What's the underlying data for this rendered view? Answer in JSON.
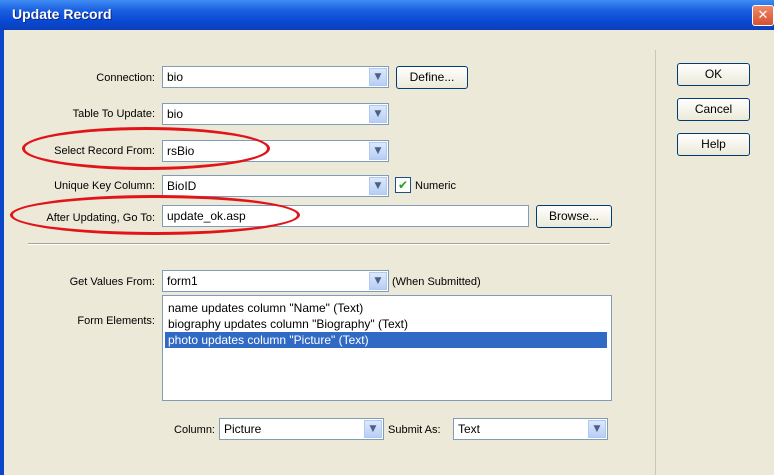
{
  "dialog": {
    "title": "Update Record",
    "close_glyph": "✕"
  },
  "form": {
    "connection": {
      "label": "Connection:",
      "value": "bio",
      "define_label": "Define..."
    },
    "table_to_update": {
      "label": "Table To Update:",
      "value": "bio"
    },
    "select_record_from": {
      "label": "Select Record From:",
      "value": "rsBio"
    },
    "unique_key_column": {
      "label": "Unique Key Column:",
      "value": "BioID",
      "numeric_label": "Numeric",
      "numeric_checked": true
    },
    "after_updating": {
      "label": "After Updating, Go To:",
      "value": "update_ok.asp",
      "browse_label": "Browse..."
    },
    "get_values_from": {
      "label": "Get Values From:",
      "value": "form1",
      "note": "(When Submitted)"
    },
    "form_elements": {
      "label": "Form Elements:",
      "items": [
        "name updates column \"Name\" (Text)",
        "biography updates column \"Biography\" (Text)",
        "photo updates column \"Picture\" (Text)"
      ],
      "selected_index": 2
    },
    "column": {
      "label": "Column:",
      "value": "Picture"
    },
    "submit_as": {
      "label": "Submit As:",
      "value": "Text"
    }
  },
  "buttons": {
    "ok": "OK",
    "cancel": "Cancel",
    "help": "Help"
  },
  "icons": {
    "dropdown": "▼",
    "check": "✔"
  },
  "colors": {
    "highlight_ellipse": "#e2141a",
    "selection": "#316ac5",
    "titlebar": "#0a49d4"
  }
}
